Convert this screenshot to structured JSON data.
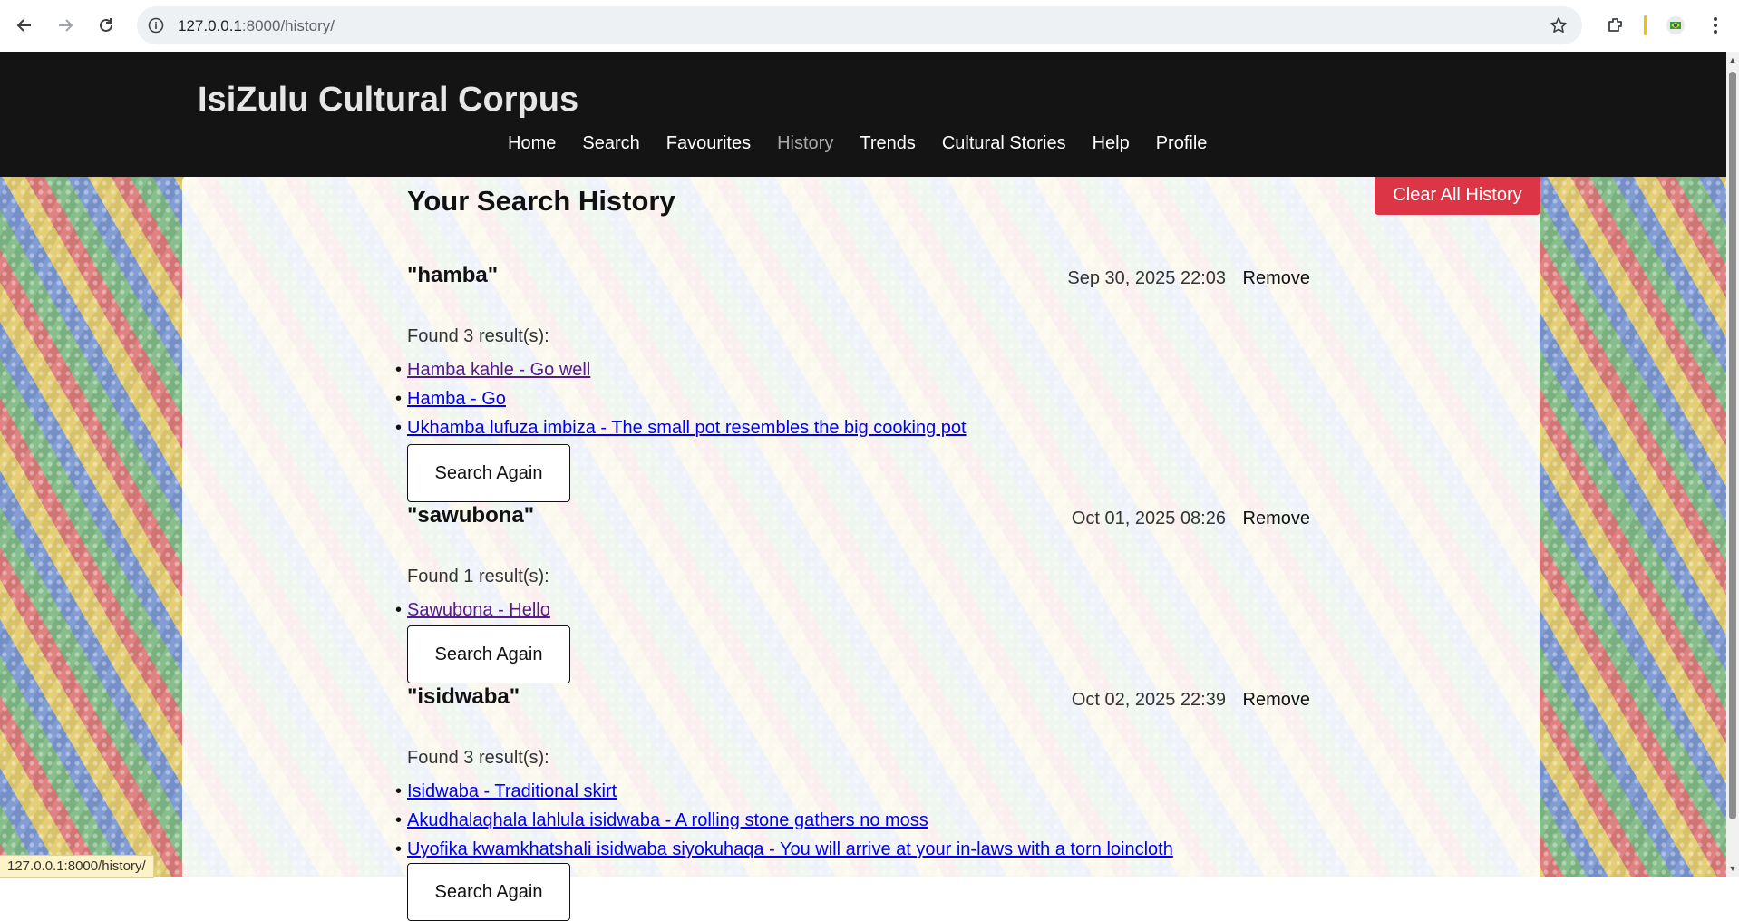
{
  "browser": {
    "url_host": "127.0.0.1",
    "url_path": ":8000/history/",
    "status_url": "127.0.0.1:8000/history/"
  },
  "site": {
    "title": "IsiZulu Cultural Corpus",
    "nav": [
      {
        "label": "Home"
      },
      {
        "label": "Search"
      },
      {
        "label": "Favourites"
      },
      {
        "label": "History"
      },
      {
        "label": "Trends"
      },
      {
        "label": "Cultural Stories"
      },
      {
        "label": "Help"
      },
      {
        "label": "Profile"
      }
    ],
    "active_nav": "History"
  },
  "history": {
    "heading": "Your Search History",
    "clear_label": "Clear All History",
    "remove_label": "Remove",
    "search_again_label": "Search Again",
    "entries": [
      {
        "query": "\"hamba\"",
        "date": "Sep 30, 2025 22:03",
        "found": "Found 3 result(s):",
        "results": [
          {
            "text": "Hamba kahle - Go well",
            "visited": true
          },
          {
            "text": "Hamba - Go",
            "visited": false
          },
          {
            "text": "Ukhamba lufuza imbiza - The small pot resembles the big cooking pot",
            "visited": false
          }
        ]
      },
      {
        "query": "\"sawubona\"",
        "date": "Oct 01, 2025 08:26",
        "found": "Found 1 result(s):",
        "results": [
          {
            "text": "Sawubona - Hello",
            "visited": true
          }
        ]
      },
      {
        "query": "\"isidwaba\"",
        "date": "Oct 02, 2025 22:39",
        "found": "Found 3 result(s):",
        "results": [
          {
            "text": "Isidwaba - Traditional skirt",
            "visited": false
          },
          {
            "text": "Akudhalaqhala lahlula isidwaba - A rolling stone gathers no moss",
            "visited": false
          },
          {
            "text": "Uyofika kwamkhatshali isidwaba siyokuhaqa - You will arrive at your in-laws with a torn loincloth",
            "visited": false
          }
        ]
      }
    ]
  },
  "colors": {
    "header_bg": "#141414",
    "clear_button": "#dc3545",
    "link": "#0000ee",
    "visited_link": "#551a8b"
  }
}
